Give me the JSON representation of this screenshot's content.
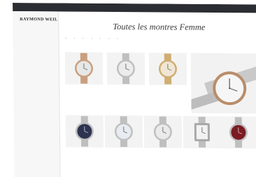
{
  "topbar": {
    "text": ""
  },
  "sidebar": {
    "brand": "RAYMOND WEIL",
    "brand_sub": "",
    "items": [
      "",
      "",
      "",
      "",
      "",
      ""
    ],
    "items_bottom": [
      "",
      ""
    ]
  },
  "breadcrumb": "",
  "page_title": "Toutes les montres Femme",
  "filters": [
    "",
    "",
    "",
    "",
    "",
    "",
    "",
    ""
  ],
  "sort_label": "",
  "subline": "",
  "countline": "",
  "products_row1": [
    {
      "brand": "",
      "name": "",
      "ref": "",
      "tag": "",
      "price": "",
      "dial": "#e7e7e7",
      "metal": "rose-gold"
    },
    {
      "brand": "",
      "name": "",
      "ref": "",
      "tag": "",
      "price": "",
      "dial": "#ececec",
      "metal": "steel"
    },
    {
      "brand": "",
      "name": "",
      "ref": "",
      "tag": "",
      "price": "",
      "dial": "#f0e6d4",
      "metal": "gold"
    }
  ],
  "products_row2": [
    {
      "brand": "",
      "name": "",
      "ref": "",
      "tag": "",
      "price": "",
      "dial": "#2d3350",
      "metal": "steel"
    },
    {
      "brand": "",
      "name": "",
      "ref": "",
      "tag": "",
      "price": "",
      "dial": "#e8ecf2",
      "metal": "steel"
    },
    {
      "brand": "",
      "name": "",
      "ref": "",
      "tag": "",
      "price": "",
      "dial": "#eaeaea",
      "metal": "steel"
    },
    {
      "brand": "",
      "name": "",
      "ref": "",
      "tag": "",
      "price": "",
      "dial": "#f2f2f2",
      "metal": "steel-square"
    },
    {
      "brand": "",
      "name": "",
      "ref": "",
      "tag": "",
      "price": "",
      "dial": "#7b1c22",
      "metal": "steel"
    }
  ],
  "feature": {
    "brand": "",
    "name": "",
    "ref": "",
    "price": ""
  },
  "colors": {
    "topbar": "#2c2c33",
    "accent": "#b88a3a",
    "text": "#333333"
  }
}
